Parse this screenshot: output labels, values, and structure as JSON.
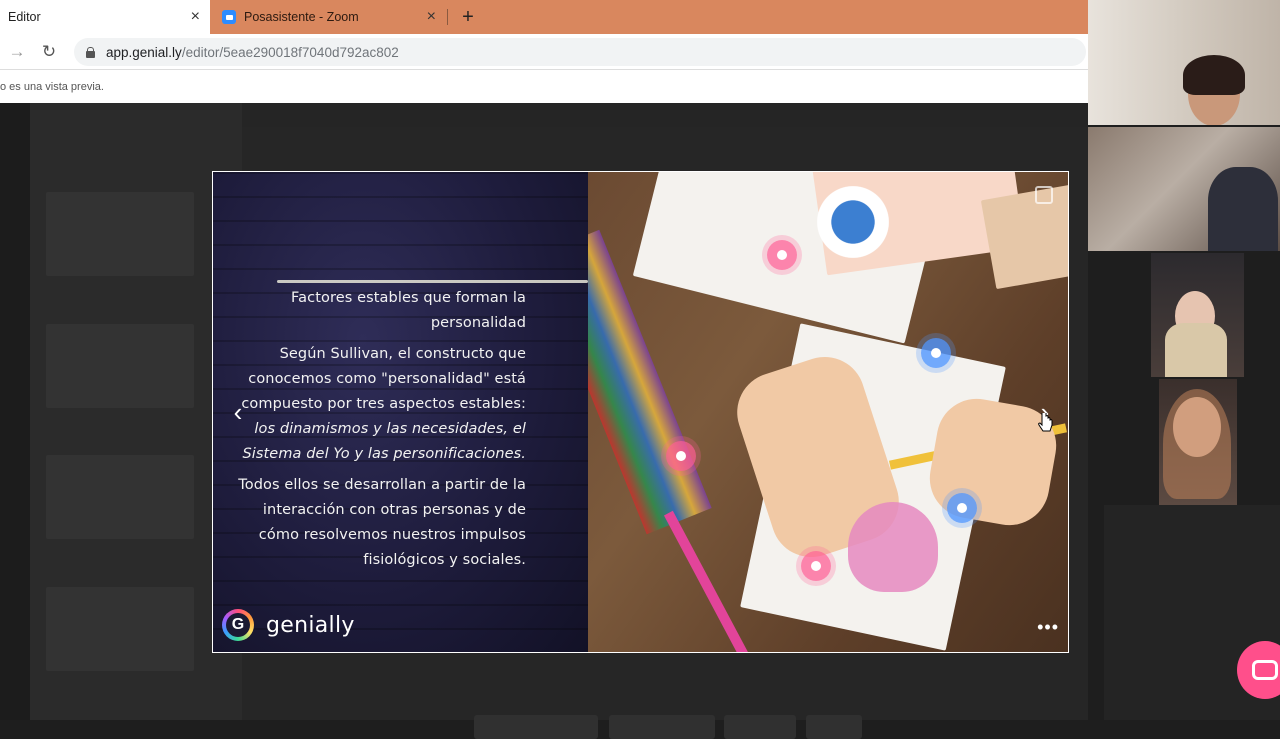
{
  "browser": {
    "tabs": [
      {
        "label": "Editor",
        "active": true
      },
      {
        "label": "Posasistente - Zoom",
        "active": false
      }
    ],
    "new_tab": "+",
    "close_glyph": "×",
    "url_host": "app.genial.ly",
    "url_path": "/editor/5eae290018f7040d792ac802",
    "notice": "o es una vista previa."
  },
  "slide": {
    "heading": "Factores estables que forman la personalidad",
    "para1_plain": "Según Sullivan, el constructo que conocemos como \"personalidad\" está compuesto por tres aspectos estables: ",
    "para1_italic": "los dinamismos y las necesidades, el Sistema del Yo y las personificaciones.",
    "para2": "Todos ellos se desarrollan a partir de la interacción con otras personas y de cómo resolvemos nuestros impulsos fisiológicos y sociales.",
    "logo_text": "genially",
    "logo_glyph": "G",
    "prev_glyph": "‹",
    "next_glyph": "›",
    "more_glyph": "•••"
  },
  "colors": {
    "tabbar": "#d9875e",
    "slide_bg": "#1e1c3c",
    "hotspot_pink": "#ff5f96",
    "hotspot_blue": "#5096ff",
    "chat_button": "#ff4f8b"
  },
  "icons": [
    "back-arrow-icon",
    "forward-arrow-icon",
    "reload-icon",
    "lock-icon",
    "zoom-icon",
    "close-icon",
    "chevron-left-icon",
    "chevron-right-icon",
    "more-icon",
    "fullscreen-icon",
    "chat-icon"
  ]
}
